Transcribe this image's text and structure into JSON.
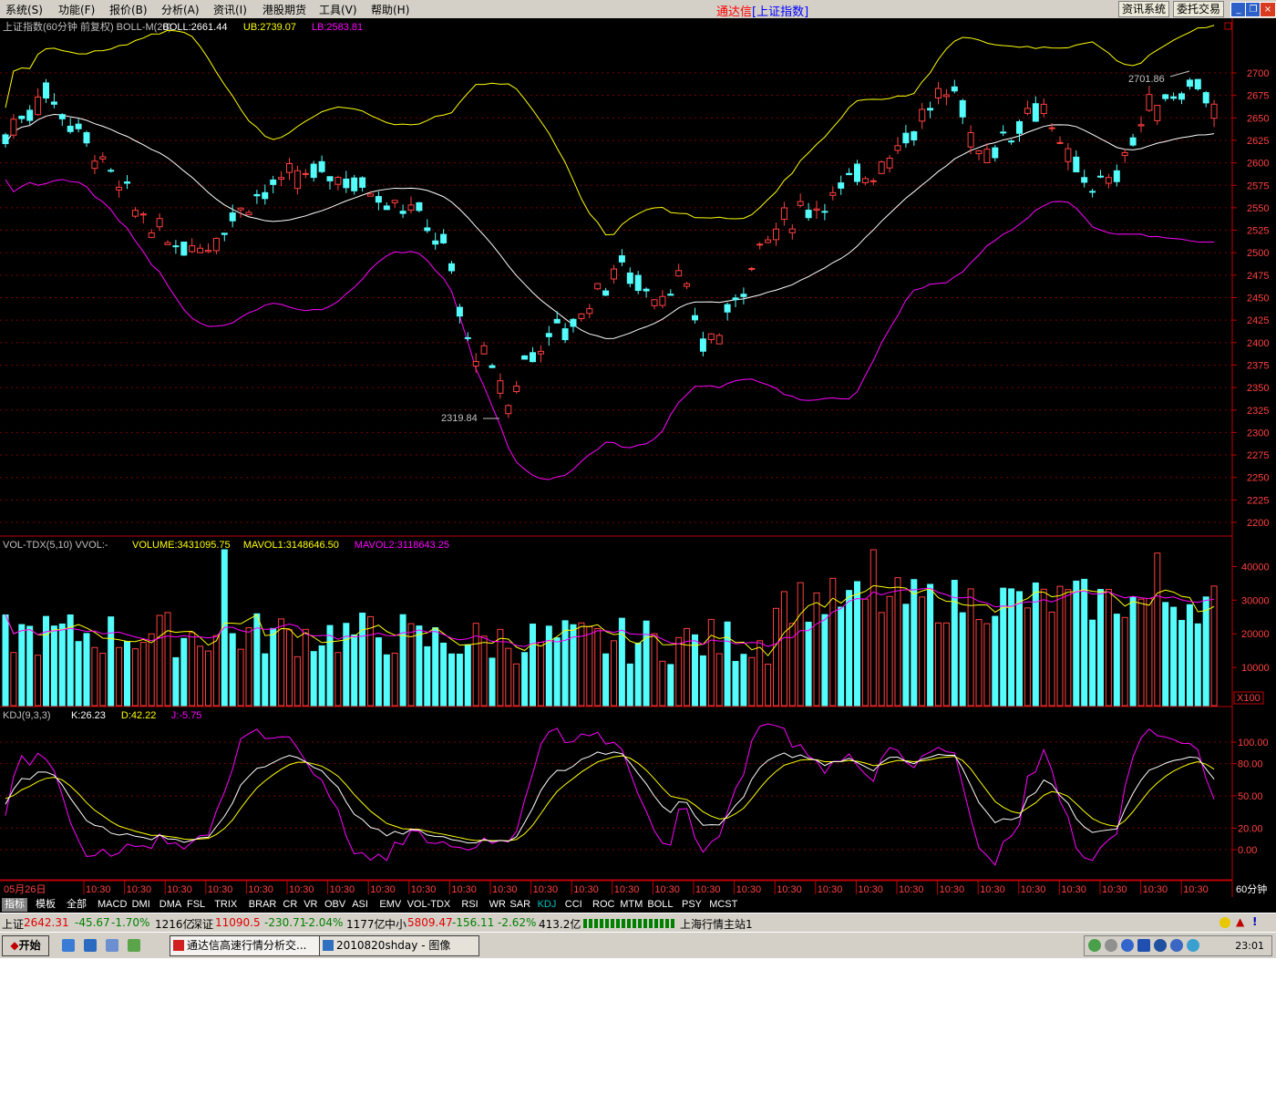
{
  "menu": [
    "系统(S)",
    "功能(F)",
    "报价(B)",
    "分析(A)",
    "资讯(I)",
    "港股期货",
    "工具(V)",
    "帮助(H)"
  ],
  "title": {
    "app": "通达信",
    "sub": "[上证指数]"
  },
  "toolbar_buttons": [
    "资讯系统",
    "委托交易"
  ],
  "main_panel": {
    "label_name": "上证指数(60分钟 前复权) BOLL-M(20)",
    "boll": "BOLL:2661.44",
    "ub": "UB:2739.07",
    "lb": "LB:2583.81",
    "y_ticks": [
      "2700",
      "2675",
      "2650",
      "2625",
      "2600",
      "2575",
      "2550",
      "2525",
      "2500",
      "2475",
      "2450",
      "2425",
      "2400",
      "2375",
      "2350",
      "2325",
      "2300",
      "2275",
      "2250",
      "2225",
      "2200"
    ],
    "marker_high": "2701.86",
    "marker_low": "2319.84"
  },
  "volume_panel": {
    "label_name": "VOL-TDX(5,10) VVOL:-",
    "volume": "VOLUME:3431095.75",
    "mavol1": "MAVOL1:3148646.50",
    "mavol2": "MAVOL2:3118643.25",
    "y_ticks": [
      "40000",
      "30000",
      "20000",
      "10000"
    ],
    "unit": "X100"
  },
  "kdj_panel": {
    "label_name": "KDJ(9,3,3)",
    "k": "K:26.23",
    "d": "D:42.22",
    "j": "J:-5.75",
    "y_ticks": [
      "100.00",
      "80.00",
      "50.00",
      "20.00",
      "0.00"
    ]
  },
  "time_axis": {
    "first": "05月26日",
    "repeat_label": "10:30",
    "period": "60分钟"
  },
  "tabs": [
    "指标",
    "模板",
    "全部",
    "MACD",
    "DMI",
    "DMA",
    "FSL",
    "TRIX",
    "BRAR",
    "CR",
    "VR",
    "OBV",
    "ASI",
    "EMV",
    "VOL-TDX",
    "RSI",
    "WR",
    "SAR",
    "KDJ",
    "CCI",
    "ROC",
    "MTM",
    "BOLL",
    "PSY",
    "MCST"
  ],
  "status": {
    "sh_name": "上证",
    "sh_value": "2642.31",
    "sh_change": "-45.67",
    "sh_pct": "-1.70%",
    "sh_amount": "1216亿",
    "sz_name": "深证",
    "sz_value": "11090.5",
    "sz_change": "-230.71",
    "sz_pct": "-2.04%",
    "sz_amount": "1177亿",
    "zx_name": "中小",
    "zx_value": "5809.47",
    "zx_change": "-156.11",
    "zx_pct": "-2.62%",
    "zx_amount": "413.2亿",
    "station": "上海行情主站1"
  },
  "taskbar": {
    "start": "开始",
    "tasks": [
      "通达信高速行情分析交...",
      "2010820shday - 图像"
    ],
    "clock": "23:01"
  },
  "colors": {
    "up": "#ff4040",
    "down": "#54fcfc",
    "boll_mid": "#ffffff",
    "boll_ub": "#ffff00",
    "boll_lb": "#ff00ff",
    "grid": "#800000",
    "axis": "#c00000"
  },
  "icons": [
    "start-flag-icon",
    "ie-icon",
    "outlook-icon",
    "desktop-icon",
    "messenger-icon",
    "app-icon",
    "image-icon",
    "volume-icon",
    "network-icon",
    "ime-icon",
    "qq-icon"
  ]
}
